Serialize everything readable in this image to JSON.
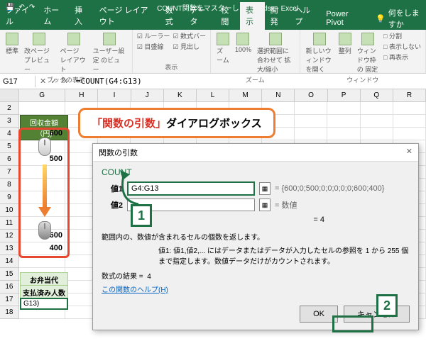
{
  "titlebar": {
    "title": "COUNT関数をマスターしよう！.xlsx - Excel"
  },
  "tabs": {
    "file": "ファイル",
    "home": "ホーム",
    "insert": "挿入",
    "layout": "ページ レイアウト",
    "formulas": "数式",
    "data": "データ",
    "review": "校閲",
    "view": "表示",
    "developer": "開発",
    "help": "ヘルプ",
    "powerpivot": "Power Pivot",
    "tellme": "何をしますか"
  },
  "ribbon": {
    "g1": {
      "btn1": "標準",
      "btn2": "改ページ\nプレビュー",
      "btn3": "ページ\nレイアウト",
      "btn4": "ユーザー設定\nのビュー",
      "label": "ブックの表示"
    },
    "g2": {
      "l1": "☑ ルーラー",
      "l2": "☑ 目盛線",
      "l3": "☑ 数式バー",
      "l4": "☑ 見出し",
      "label": "表示"
    },
    "g3": {
      "btn1": "ズーム",
      "btn2": "100%",
      "btn3": "選択範囲に合わせて\n拡大/縮小",
      "label": "ズーム"
    },
    "g4": {
      "btn1": "新しいウィンドウ\nを開く",
      "btn2": "整列",
      "btn3": "ウィンドウ枠の\n固定",
      "l1": "□ 分割",
      "l2": "□ 表示しない",
      "l3": "□ 再表示",
      "label": "ウィンドウ"
    }
  },
  "formula_bar": {
    "name_box": "G17",
    "formula": "=COUNT(G4:G13)"
  },
  "columns": [
    "G",
    "H",
    "I",
    "J",
    "K",
    "L",
    "M",
    "N",
    "O",
    "P",
    "Q",
    "R"
  ],
  "rows": [
    2,
    3,
    4,
    5,
    6,
    7,
    8,
    9,
    10,
    11,
    12,
    13,
    14,
    15,
    16,
    17,
    18
  ],
  "sheet": {
    "header": "回収金額（円)",
    "v4": "600",
    "v6": "500",
    "v12": "600",
    "v13": "400",
    "label1": "お弁当代",
    "label2": "支払済み人数",
    "cell_g17": "G13)"
  },
  "annotation": {
    "red": "「関数の引数」",
    "rest": "ダイアログボックス"
  },
  "dialog": {
    "title": "関数の引数",
    "func": "COUNT",
    "arg1_label": "値1",
    "arg1_value": "G4:G13",
    "arg1_result": "{600;0;500;0;0;0;0;0;600;400}",
    "arg2_label": "値2",
    "arg2_result": "数値",
    "mid_result": "=    4",
    "desc": "範囲内の、数値が含まれるセルの個数を返します。",
    "desc2": "値1: 値1,値2,... にはデータまたはデータが入力したセルの参照を 1 から 255 個まで指定します。数値データだけがカウントされます。",
    "result_label": "数式の結果 =",
    "result_value": "4",
    "help": "この関数のヘルプ(H)",
    "ok": "OK",
    "cancel": "キャンセル"
  },
  "callouts": {
    "n1": "1",
    "n2": "2"
  }
}
